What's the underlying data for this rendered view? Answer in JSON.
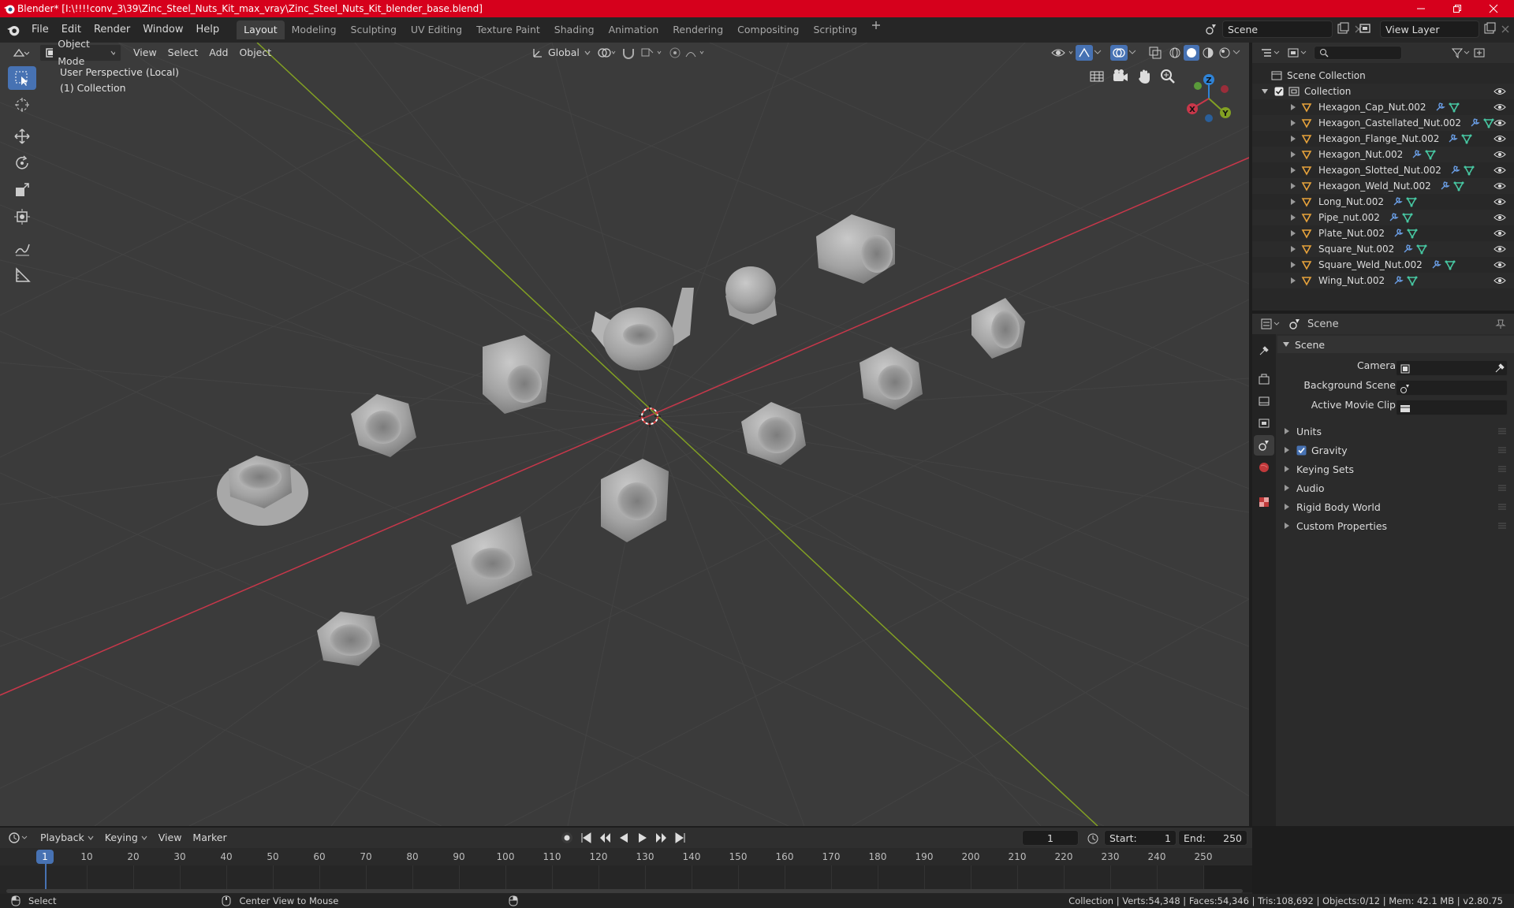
{
  "window": {
    "title": "Blender* [I:\\!!!!conv_3\\39\\Zinc_Steel_Nuts_Kit_max_vray\\Zinc_Steel_Nuts_Kit_blender_base.blend]"
  },
  "menubar": {
    "menus": [
      "File",
      "Edit",
      "Render",
      "Window",
      "Help"
    ],
    "workspaces": [
      "Layout",
      "Modeling",
      "Sculpting",
      "UV Editing",
      "Texture Paint",
      "Shading",
      "Animation",
      "Rendering",
      "Compositing",
      "Scripting"
    ],
    "active_workspace": "Layout",
    "scene": "Scene",
    "view_layer": "View Layer"
  },
  "viewport": {
    "mode": "Object Mode",
    "menus": [
      "View",
      "Select",
      "Add",
      "Object"
    ],
    "orientation": "Global",
    "overlay_line1": "User Perspective (Local)",
    "overlay_line2": "(1) Collection",
    "gizmo_axes": {
      "x": "X",
      "y": "Y",
      "z": "Z"
    },
    "colors": {
      "x_axis": "#c8374a",
      "y_axis": "#82a023",
      "z_axis": "#2f83d6",
      "background": "#3b3b3b",
      "selection": "#4772b3"
    }
  },
  "outliner": {
    "search_placeholder": "",
    "root": "Scene Collection",
    "collection": "Collection",
    "items": [
      "Hexagon_Cap_Nut.002",
      "Hexagon_Castellated_Nut.002",
      "Hexagon_Flange_Nut.002",
      "Hexagon_Nut.002",
      "Hexagon_Slotted_Nut.002",
      "Hexagon_Weld_Nut.002",
      "Long_Nut.002",
      "Pipe_nut.002",
      "Plate_Nut.002",
      "Square_Nut.002",
      "Square_Weld_Nut.002",
      "Wing_Nut.002"
    ]
  },
  "properties": {
    "context": "Scene",
    "panel": "Scene",
    "camera_label": "Camera",
    "background_scene_label": "Background Scene",
    "active_movie_clip_label": "Active Movie Clip",
    "sections": [
      "Units",
      "Gravity",
      "Keying Sets",
      "Audio",
      "Rigid Body World",
      "Custom Properties"
    ],
    "gravity_checked": true
  },
  "timeline": {
    "menus": [
      "Playback",
      "Keying",
      "View",
      "Marker"
    ],
    "current_frame": "1",
    "start_label": "Start:",
    "start": "1",
    "end_label": "End:",
    "end": "250",
    "ruler": [
      "1",
      "10",
      "20",
      "30",
      "40",
      "50",
      "60",
      "70",
      "80",
      "90",
      "100",
      "110",
      "120",
      "130",
      "140",
      "150",
      "160",
      "170",
      "180",
      "190",
      "200",
      "210",
      "220",
      "230",
      "240",
      "250"
    ]
  },
  "statusbar": {
    "left_action": "Select",
    "middle_action": "Center View to Mouse",
    "stats": "Collection | Verts:54,348 | Faces:54,346 | Tris:108,692 | Objects:0/12 | Mem: 42.1 MB | v2.80.75"
  }
}
